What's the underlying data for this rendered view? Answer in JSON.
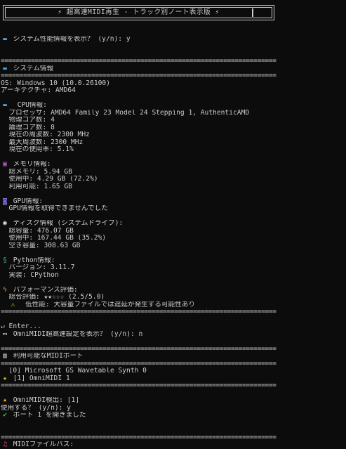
{
  "banner": {
    "title": "⚡ 超高速MIDI再生 - トラック別ノート表示版 ⚡"
  },
  "separator": "=========================================================================",
  "prompt_sysinfo": "システム性能情報を表示？ (y/n): y",
  "sysinfo_header": "システム情報",
  "os": "OS: Windows 10 (10.0.26100)",
  "arch": "アーキテクチャ: AMD64",
  "cpu": {
    "header": "CPU情報:",
    "processor": "  プロセッサ: AMD64 Family 23 Model 24 Stepping 1, AuthenticAMD",
    "physical": "  物理コア数: 4",
    "logical": "  論理コア数: 8",
    "freq_current": "  現在の周波数: 2300 MHz",
    "freq_max": "  最大周波数: 2300 MHz",
    "usage": "  現在の使用率: 5.1%"
  },
  "memory": {
    "header": "メモリ情報:",
    "total": "  総メモリ: 5.94 GB",
    "used": "  使用中: 4.29 GB (72.2%)",
    "available": "  利用可能: 1.65 GB"
  },
  "gpu": {
    "header": "GPU情報:",
    "status": "  GPU情報を取得できませんでした"
  },
  "disk": {
    "header": "ディスク情報 (システムドライブ):",
    "total": "  総容量: 476.07 GB",
    "used": "  使用中: 167.44 GB (35.2%)",
    "free": "  空き容量: 308.63 GB"
  },
  "python": {
    "header": "Python情報:",
    "version": "  バージョン: 3.11.7",
    "impl": "  実装: CPython"
  },
  "perf": {
    "header": "パフォーマンス評価:",
    "rating": "  総合評価: ★★☆☆☆ (2.5/5.0)",
    "warning": "低性能: 大容量ファイルでは遅延が発生する可能性あり"
  },
  "enter_prompt": "↵ Enter...",
  "omni_settings_prompt": "OmniMIDI超高速設定を表示？ (y/n): n",
  "midi_ports_header": "利用可能なMIDIポート",
  "midi_ports": [
    "  [0] Microsoft GS Wavetable Synth 0",
    "[1] OmniMIDI 1"
  ],
  "omni_detect": "OmniMIDI検出: [1]",
  "use_prompt": "使用する？ (y/n): y",
  "port_opened": "ポート 1 を開きました",
  "midi_path_label": "MIDIファイルパス:",
  "icons": {
    "pc": "computer-icon",
    "memory": "floppy-disk-icon",
    "gpu": "gamepad-icon",
    "disk": "disc-icon",
    "python": "python-icon",
    "perf": "lightning-icon",
    "warning": "warning-icon",
    "omni": "book-icon",
    "ports": "piano-icon",
    "star": "star-icon",
    "check": "checkmark-icon",
    "midi": "music-note-icon"
  }
}
